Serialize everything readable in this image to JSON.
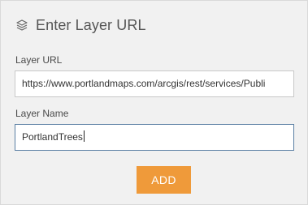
{
  "header": {
    "icon": "layers-icon",
    "title": "Enter Layer URL"
  },
  "form": {
    "url_label": "Layer URL",
    "url_value": "https://www.portlandmaps.com/arcgis/rest/services/Publi",
    "name_label": "Layer Name",
    "name_value": "PortlandTrees"
  },
  "actions": {
    "add_label": "ADD"
  },
  "colors": {
    "accent": "#ef9a3a",
    "panel": "#f1f1f1",
    "focus_border": "#5a7fa3"
  }
}
